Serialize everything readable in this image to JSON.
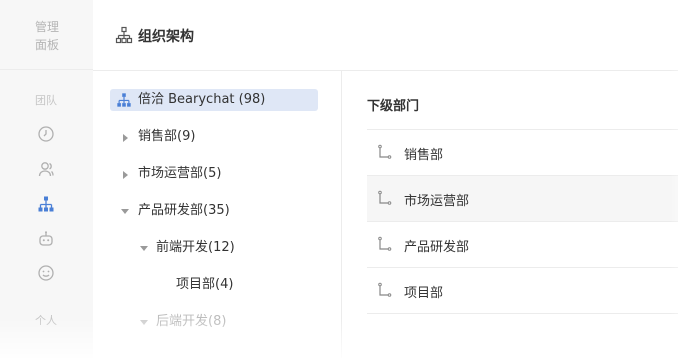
{
  "sidebar": {
    "title_line1": "管理",
    "title_line2": "面板",
    "section_team": "团队",
    "section_personal": "个人",
    "icons": [
      "clock-icon",
      "users-icon",
      "org-chart-icon",
      "robot-icon",
      "smile-icon"
    ],
    "active_color": "#4a7fd6"
  },
  "header": {
    "title": "组织架构"
  },
  "tree": {
    "items": [
      {
        "label": "倍洽 Bearychat (98)",
        "selected": true
      },
      {
        "label": "销售部(9)"
      },
      {
        "label": "市场运营部(5)"
      },
      {
        "label": "产品研发部(35)"
      },
      {
        "label": "前端开发(12)"
      },
      {
        "label": "项目部(4)"
      },
      {
        "label": "后端开发(8)"
      }
    ]
  },
  "subdepartments": {
    "title": "下级部门",
    "items": [
      {
        "label": "销售部"
      },
      {
        "label": "市场运营部"
      },
      {
        "label": "产品研发部"
      },
      {
        "label": "项目部"
      }
    ]
  }
}
